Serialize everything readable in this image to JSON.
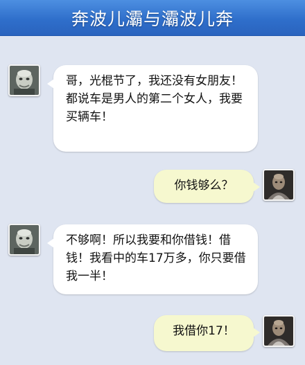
{
  "header": {
    "title": "奔波儿灞与灞波儿奔"
  },
  "messages": [
    {
      "sender": "left",
      "avatar_icon": "old-man-avatar-icon",
      "text": "哥，光棍节了，我还没有女朋友！都说车是男人的第二个女人，我要买辆车！"
    },
    {
      "sender": "right",
      "avatar_icon": "bald-man-avatar-icon",
      "text": "你钱够么？"
    },
    {
      "sender": "left",
      "avatar_icon": "old-man-avatar-icon",
      "text": "不够啊！所以我要和你借钱！借钱！我看中的车17万多，你只要借我一半！"
    },
    {
      "sender": "right",
      "avatar_icon": "bald-man-avatar-icon",
      "text": "我借你17！"
    }
  ],
  "colors": {
    "header_blue": "#2f6fcb",
    "chat_background": "#dfe5f1",
    "left_bubble": "#ffffff",
    "right_bubble": "#f6f8cf"
  }
}
